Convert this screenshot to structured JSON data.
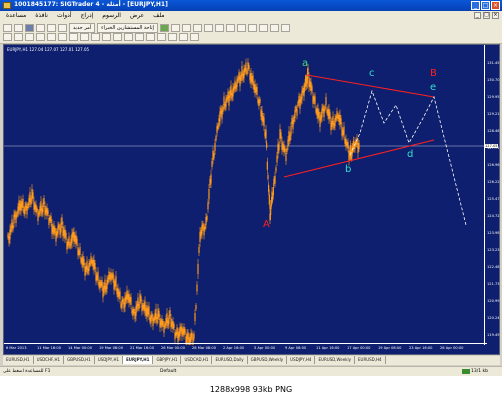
{
  "window": {
    "title": "1001845177: SIGTrader 4 - أمثلة - [EURJPY,H1]",
    "minimize": "_",
    "maximize": "□",
    "close": "×"
  },
  "menu": {
    "items": [
      "مساعدة",
      "نافذة",
      "أدوات",
      "إدراج",
      "الرسوم",
      "عرض",
      "ملف"
    ],
    "mdi": [
      "_",
      "□",
      "×"
    ]
  },
  "toolbar": {
    "new_order": "أمر جديد",
    "expert_advisors": "إتاحة المستشارين الخبراء"
  },
  "chart": {
    "symbol_line": "EURJPY,H1 127.04 127.07 127.01 127.05",
    "price_labels": [
      "131.45",
      "130.70",
      "129.95",
      "129.21",
      "128.46",
      "127.71",
      "126.96",
      "126.22",
      "125.47",
      "124.72",
      "123.98",
      "123.23",
      "122.48",
      "121.73",
      "120.99",
      "120.24",
      "119.49"
    ],
    "current_price": "127.05",
    "time_labels": [
      "6 Mar 2013",
      "11 Mar 16:00",
      "14 Mar 00:00",
      "19 Mar 08:00",
      "21 Mar 16:00",
      "26 Mar 00:00",
      "28 Mar 08:00",
      "2 Apr 16:00",
      "5 Apr 00:00",
      "9 Apr 08:00",
      "11 Apr 16:00",
      "17 Apr 00:00",
      "19 Apr 08:00",
      "23 Apr 16:00",
      "26 Apr 00:00"
    ],
    "wave_labels": {
      "A": "A",
      "B": "B",
      "a": "a",
      "b": "b",
      "c": "c",
      "d": "d",
      "e": "e"
    },
    "colors": {
      "background": "#0d1f6e",
      "candles": "#ff9a1a",
      "triangle": "#ff2020",
      "projection": "#ffffff",
      "label_red": "#ff2020",
      "label_cyan": "#33e0d0",
      "label_a": "#3fe07f"
    }
  },
  "tabs": [
    "EURUSD,H1",
    "USDCHF,H1",
    "GBPUSD,H1",
    "USDJPY,H1",
    "EURJPY,H1",
    "GBPJPY,H1",
    "USDCAD,H1",
    "EURUSD,Daily",
    "GBPUSD,Weekly",
    "USDJPY,H4",
    "EURUSD,Weekly",
    "EURUSD,H4"
  ],
  "active_tab": "EURJPY,H1",
  "status": {
    "help": "للمساعدة اضغط على F1",
    "profile": "Default",
    "connection": "13/1 kb"
  },
  "footer": {
    "caption": "1288x998  93kb  PNG"
  }
}
